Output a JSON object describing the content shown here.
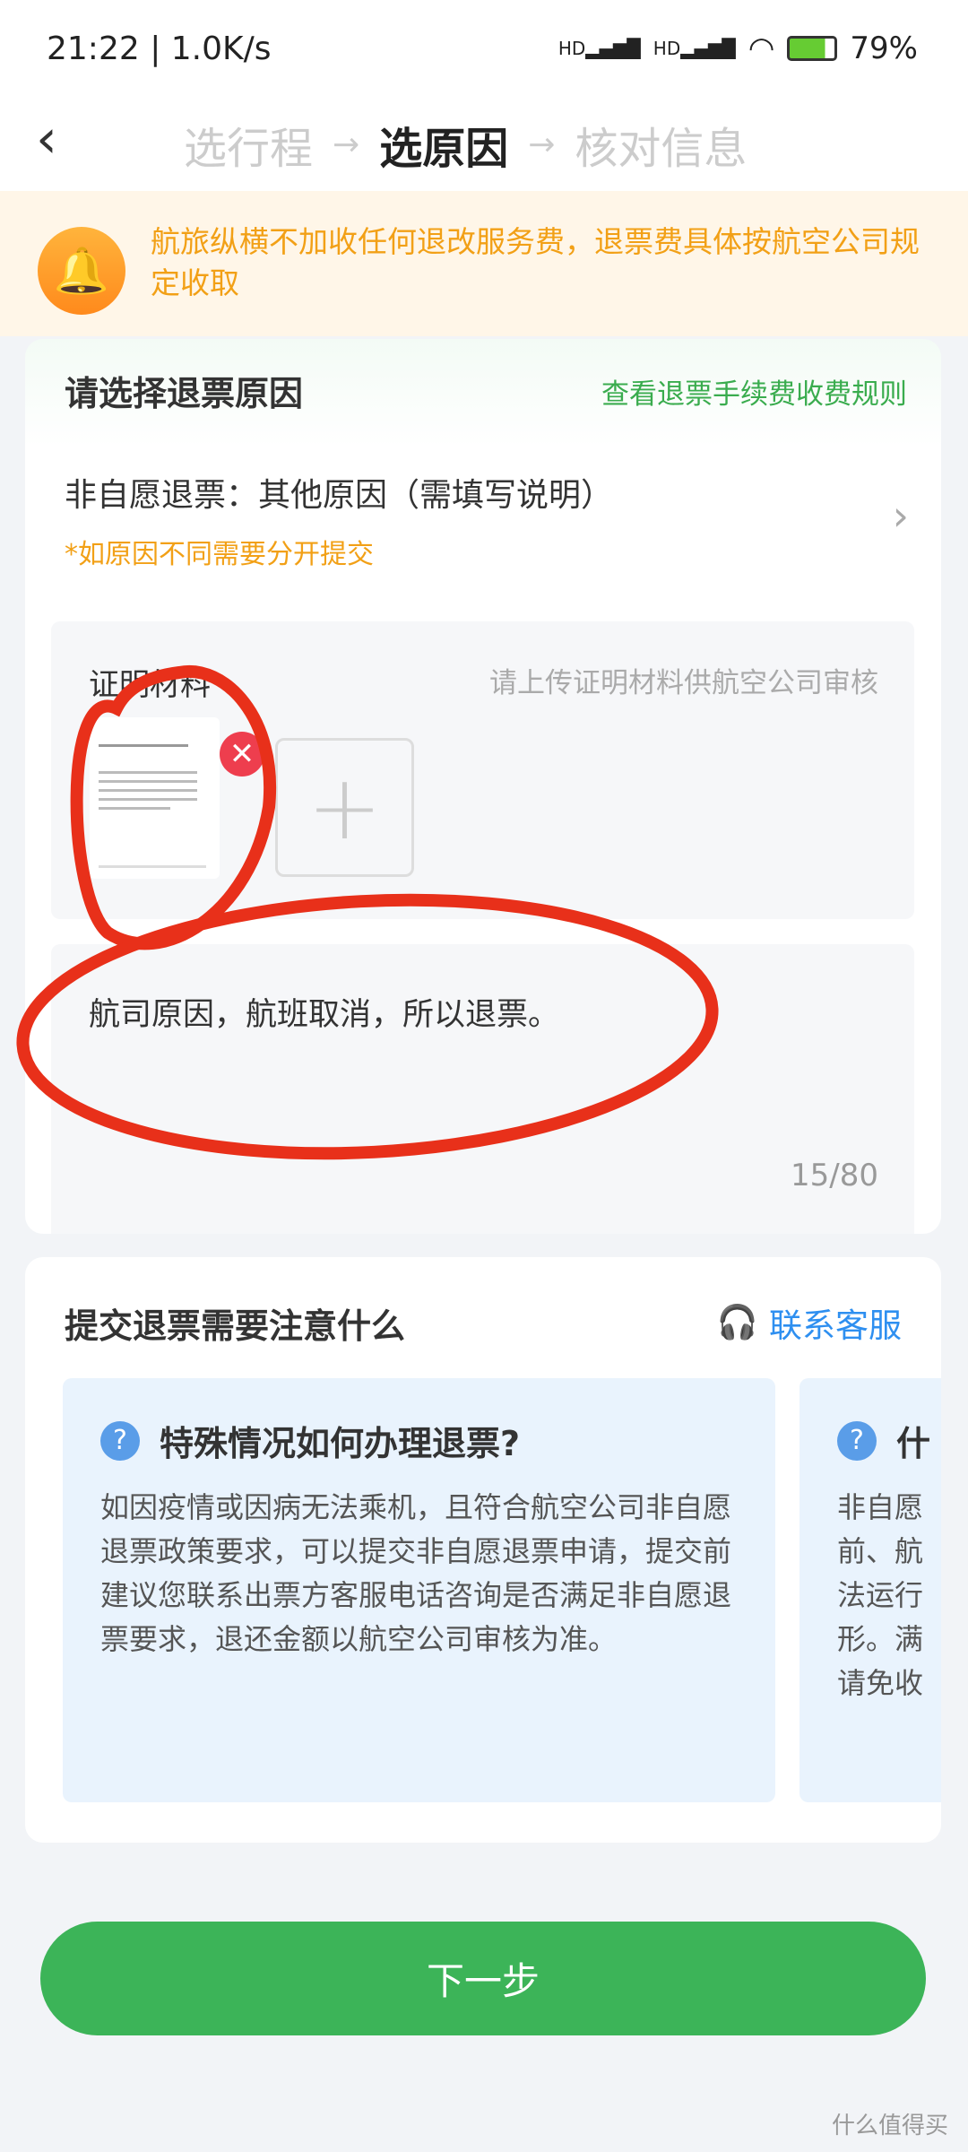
{
  "status": {
    "time": "21:22 | 1.0K/s",
    "signal": "HD",
    "battery": "79%"
  },
  "nav": {
    "steps": [
      "选行程",
      "选原因",
      "核对信息"
    ],
    "active": 1,
    "arrow": "→"
  },
  "banner": {
    "text": "航旅纵横不加收任何退改服务费，退票费具体按航空公司规定收取"
  },
  "reason_card": {
    "title": "请选择退票原因",
    "rule_link": "查看退票手续费收费规则",
    "reason": "非自愿退票：其他原因（需填写说明）",
    "note": "*如原因不同需要分开提交",
    "upload": {
      "label": "证明材料",
      "hint": "请上传证明材料供航空公司审核"
    },
    "description": {
      "value": "航司原因，航班取消，所以退票。",
      "counter": "15/80"
    }
  },
  "tips_card": {
    "title": "提交退票需要注意什么",
    "contact": "联系客服",
    "tips": [
      {
        "title": "特殊情况如何办理退票?",
        "body": "如因疫情或因病无法乘机，且符合航空公司非自愿退票政策要求，可以提交非自愿退票申请，提交前建议您联系出票方客服电话咨询是否满足非自愿退票要求，退还金额以航空公司审核为准。"
      },
      {
        "title": "什",
        "body": "非自愿 前、航 法运行 形。满 请免收"
      }
    ]
  },
  "next_button": "下一步",
  "watermark": "什么值得买",
  "colors": {
    "accent": "#3cb458",
    "warning": "#f2a016",
    "link": "#2e8ff0",
    "annotation": "#e8301a"
  }
}
